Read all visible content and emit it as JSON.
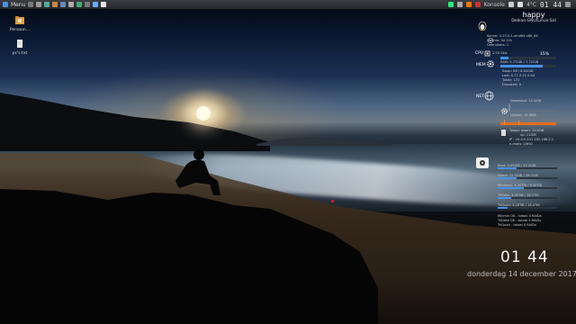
{
  "taskbar": {
    "menu_label": "Menu",
    "window_label": "Konsole",
    "temperature": "4°C",
    "clock": "01 44"
  },
  "desktop_icons": [
    {
      "label": "Persoon...",
      "icon": "folder-icon"
    },
    {
      "label": "pc's.txt",
      "icon": "text-file-icon"
    }
  ],
  "conky": {
    "hostname": "happy",
    "os": "Debian GNU/Linux Sid",
    "kernel": "Kernel: 4.13.0-1-amd64 x86_64",
    "uptime": "Uptime: 3d 11h",
    "users": "Gebruikers: 1",
    "cpu_label": "CPU",
    "cpu_freq": "2.50 GHz",
    "cpu_percent": "15%",
    "cpu_fraction": 0.15,
    "mem_label": "MEM",
    "ram": "RAM: 5.77GiB / 7.72GiB",
    "ram_fraction": 0.75,
    "swap": "Swap: 0B / 8.02GiB",
    "load": "Last: 0.72 0.52 0.44",
    "tasks": "Taken: 172",
    "threads": "Draaiend: 0",
    "net_label": "NET",
    "download": "Download: 15.1KiB",
    "upload": "Upload: 15.9KiB",
    "total_down": "Totaal: down: 124GiB",
    "total_up": "up: 11GiB",
    "ip": "IP : 10.0.0.101 192.168.0.1",
    "email": "e-mails: 0/692",
    "root": "Root: 5.45GiB / 17.2GiB",
    "home": "Home: 11.5GiB / 36.0GiB",
    "windows": "Windows: 4.20TiB / 9.50TiB",
    "data": "TriData: 3.95TiB / 18.2TiB",
    "quad": "TriQuad: 3.20TiB / 18.4TiB",
    "raid1": "Minmin OK - totaal 4 RAIDs",
    "raid2": "TriData OK - totaal 4 RAIDs",
    "raid3": "TriQuad - totaal 4 RAIDs",
    "disk_fractions": [
      0.32,
      0.32,
      0.44,
      0.22,
      0.17
    ]
  },
  "clock": {
    "time": "01 44",
    "date": "donderdag 14 december 2017"
  }
}
